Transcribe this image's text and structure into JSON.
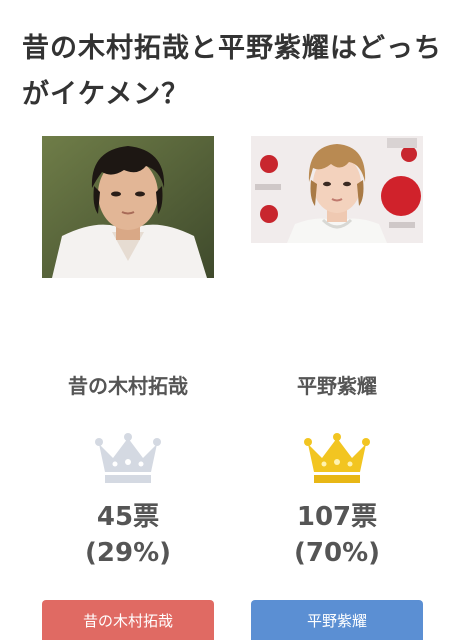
{
  "question": "昔の木村拓哉と平野紫耀はどっちがイケメン？",
  "colors": {
    "silver_crown": "#d4d9e2",
    "gold_crown": "#f2c521",
    "button_a": "#e06a63",
    "button_b": "#5b8fd3"
  },
  "options": [
    {
      "name": "昔の木村拓哉",
      "votes": "45票",
      "percent": "(29%)",
      "percent_value": 29,
      "crown": "silver-crown-icon",
      "button_label": "昔の木村拓哉"
    },
    {
      "name": "平野紫耀",
      "votes": "107票",
      "percent": "(70%)",
      "percent_value": 70,
      "crown": "gold-crown-icon",
      "button_label": "平野紫耀"
    }
  ]
}
